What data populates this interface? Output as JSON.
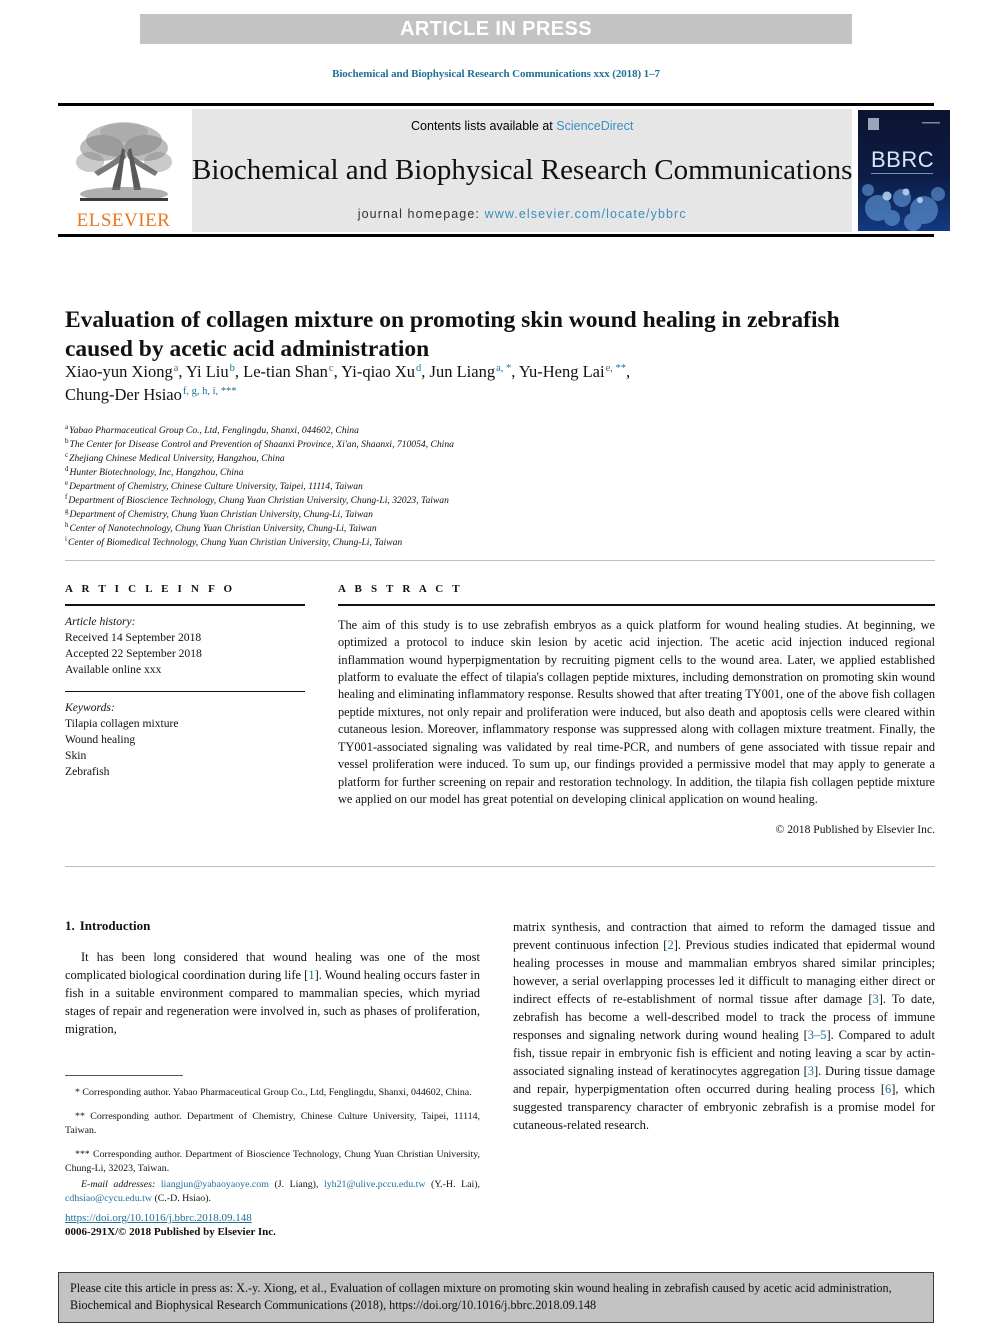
{
  "banner": {
    "text": "ARTICLE IN PRESS"
  },
  "running_head": "Biochemical and Biophysical Research Communications xxx (2018) 1–7",
  "masthead": {
    "contents_prefix": "Contents lists available at ",
    "sciencedirect": "ScienceDirect",
    "journal_name": "Biochemical and Biophysical Research Communications",
    "homepage_label": "journal homepage: ",
    "homepage_url": "www.elsevier.com/locate/ybbrc",
    "publisher": "ELSEVIER",
    "cover_title": "BBRC",
    "accent_color": "#3a8fbf",
    "publisher_color": "#e87722"
  },
  "article": {
    "title": "Evaluation of collagen mixture on promoting skin wound healing in zebrafish caused by acetic acid administration"
  },
  "authors": {
    "line1": "Xiao-yun Xiong , Yi Liu , Le-tian Shan , Yi-qiao Xu , Jun Liang , Yu-Heng Lai ,",
    "line2": "Chung-Der Hsiao",
    "list": [
      {
        "name": "Xiao-yun Xiong",
        "marks": "a"
      },
      {
        "name": "Yi Liu",
        "marks": "b"
      },
      {
        "name": "Le-tian Shan",
        "marks": "c"
      },
      {
        "name": "Yi-qiao Xu",
        "marks": "d"
      },
      {
        "name": "Jun Liang",
        "marks": "a, *"
      },
      {
        "name": "Yu-Heng Lai",
        "marks": "e, **"
      },
      {
        "name": "Chung-Der Hsiao",
        "marks": "f, g, h, i, ***"
      }
    ]
  },
  "affiliations": [
    {
      "mark": "a",
      "text": "Yabao Pharmaceutical Group Co., Ltd, Fenglingdu, Shanxi, 044602, China"
    },
    {
      "mark": "b",
      "text": "The Center for Disease Control and Prevention of Shaanxi Province, Xi'an, Shaanxi, 710054, China"
    },
    {
      "mark": "c",
      "text": "Zhejiang Chinese Medical University, Hangzhou, China"
    },
    {
      "mark": "d",
      "text": "Hunter Biotechnology, Inc, Hangzhou, China"
    },
    {
      "mark": "e",
      "text": "Department of Chemistry, Chinese Culture University, Taipei, 11114, Taiwan"
    },
    {
      "mark": "f",
      "text": "Department of Bioscience Technology, Chung Yuan Christian University, Chung-Li, 32023, Taiwan"
    },
    {
      "mark": "g",
      "text": "Department of Chemistry, Chung Yuan Christian University, Chung-Li, Taiwan"
    },
    {
      "mark": "h",
      "text": "Center of Nanotechnology, Chung Yuan Christian University, Chung-Li, Taiwan"
    },
    {
      "mark": "i",
      "text": "Center of Biomedical Technology, Chung Yuan Christian University, Chung-Li, Taiwan"
    }
  ],
  "article_info": {
    "heading": "A R T I C L E   I N F O",
    "history_label": "Article history:",
    "history": [
      "Received 14 September 2018",
      "Accepted 22 September 2018",
      "Available online xxx"
    ],
    "keywords_label": "Keywords:",
    "keywords": [
      "Tilapia collagen mixture",
      "Wound healing",
      "Skin",
      "Zebrafish"
    ]
  },
  "abstract": {
    "heading": "A B S T R A C T",
    "text": "The aim of this study is to use zebrafish embryos as a quick platform for wound healing studies. At beginning, we optimized a protocol to induce skin lesion by acetic acid injection. The acetic acid injection induced regional inflammation wound hyperpigmentation by recruiting pigment cells to the wound area. Later, we applied established platform to evaluate the effect of tilapia's collagen peptide mixtures, including demonstration on promoting skin wound healing and eliminating inflammatory response. Results showed that after treating TY001, one of the above fish collagen peptide mixtures, not only repair and proliferation were induced, but also death and apoptosis cells were cleared within cutaneous lesion. Moreover, inflammatory response was suppressed along with collagen mixture treatment. Finally, the TY001-associated signaling was validated by real time-PCR, and numbers of gene associated with tissue repair and vessel proliferation were induced. To sum up, our findings provided a permissive model that may apply to generate a platform for further screening on repair and restoration technology. In addition, the tilapia fish collagen peptide mixture we applied on our model has great potential on developing clinical application on wound healing.",
    "copyright": "© 2018 Published by Elsevier Inc."
  },
  "body": {
    "section_number": "1.",
    "section_title": "Introduction",
    "left_paragraph_part1": "It has been long considered that wound healing was one of the most complicated biological coordination during life [",
    "left_ref1": "1",
    "left_paragraph_part2": "]. Wound healing occurs faster in fish in a suitable environment compared to mammalian species, which myriad stages of repair and regeneration were involved in, such as phases of proliferation, migration,",
    "right_p1": "matrix synthesis, and contraction that aimed to reform the damaged tissue and prevent continuous infection [",
    "right_ref2": "2",
    "right_p2": "]. Previous studies indicated that epidermal wound healing processes in mouse and mammalian embryos shared similar principles; however, a serial overlapping processes led it difficult to managing either direct or indirect effects of re-establishment of normal tissue after damage [",
    "right_ref3": "3",
    "right_p3": "]. To date, zebrafish has become a well-described model to track the process of immune responses and signaling network during wound healing [",
    "right_ref4": "3–5",
    "right_p4": "]. Compared to adult fish, tissue repair in embryonic fish is efficient and noting leaving a scar by actin-associated signaling instead of keratinocytes aggregation [",
    "right_ref5": "3",
    "right_p5": "]. During tissue damage and repair, hyperpigmentation often occurred during healing process [",
    "right_ref6": "6",
    "right_p6": "], which suggested transparency character of embryonic zebrafish is a promise model for cutaneous-related research."
  },
  "footnotes": {
    "corr1": "* Corresponding author. Yabao Pharmaceutical Group Co., Ltd, Fenglingdu, Shanxi, 044602, China.",
    "corr2": "** Corresponding author. Department of Chemistry, Chinese Culture University, Taipei, 11114, Taiwan.",
    "corr3": "*** Corresponding author. Department of Bioscience Technology, Chung Yuan Christian University, Chung-Li, 32023, Taiwan.",
    "email_label": "E-mail addresses:",
    "email1": "liangjun@yabaoyaoye.com",
    "email1_who": "(J. Liang),",
    "email2": "lyh21@ulive.pccu.edu.tw",
    "email2_who": "(Y.-H. Lai),",
    "email3": "cdhsiao@cycu.edu.tw",
    "email3_who": "(C.-D. Hsiao)."
  },
  "doi": {
    "url": "https://doi.org/10.1016/j.bbrc.2018.09.148",
    "issn_line": "0006-291X/© 2018 Published by Elsevier Inc."
  },
  "cite_footer": {
    "text": "Please cite this article in press as: X.-y. Xiong, et al., Evaluation of collagen mixture on promoting skin wound healing in zebrafish caused by acetic acid administration, Biochemical and Biophysical Research Communications (2018), https://doi.org/10.1016/j.bbrc.2018.09.148"
  }
}
